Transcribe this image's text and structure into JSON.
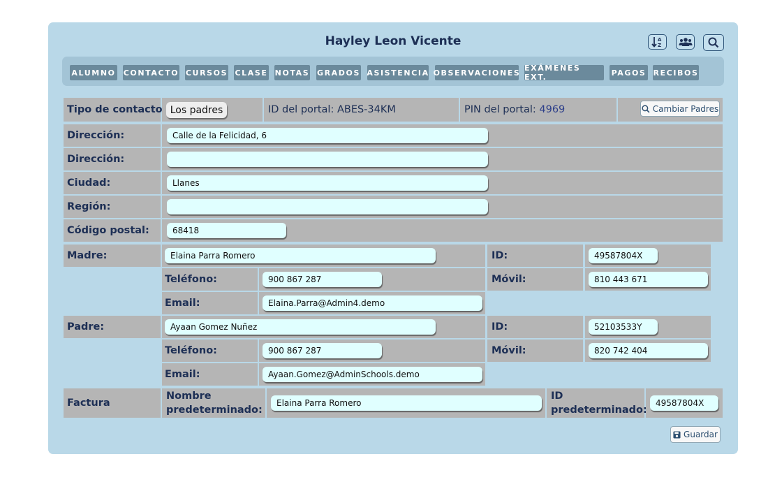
{
  "header": {
    "title": "Hayley Leon Vicente"
  },
  "toolbar": {
    "sort_icon": "sort-alpha-icon",
    "group_icon": "users-icon",
    "search_icon": "search-icon"
  },
  "tabs": [
    "ALUMNO",
    "CONTACTO",
    "CURSOS",
    "CLASE",
    "NOTAS",
    "GRADOS",
    "ASISTENCIA",
    "OBSERVACIONES",
    "EXÁMENES EXT.",
    "PAGOS",
    "RECIBOS"
  ],
  "form": {
    "tipo_label": "Tipo de contacto:",
    "tipo_value": "Los padres",
    "portal_id_label": "ID del portal:",
    "portal_id_value": "ABES-34KM",
    "pin_label": "PIN del portal:",
    "pin_value": "4969",
    "change_parents": "Cambiar Padres",
    "direccion1_label": "Dirección:",
    "direccion1_value": "Calle de la Felicidad, 6",
    "direccion2_label": "Dirección:",
    "direccion2_value": "",
    "ciudad_label": "Ciudad:",
    "ciudad_value": "Llanes",
    "region_label": "Región:",
    "region_value": "",
    "cp_label": "Código postal:",
    "cp_value": "68418",
    "madre_label": "Madre:",
    "madre_name": "Elaina Parra Romero",
    "madre_id_label": "ID:",
    "madre_id": "49587804X",
    "madre_tel_label": "Teléfono:",
    "madre_tel": "900 867 287",
    "madre_movil_label": "Móvil:",
    "madre_movil": "810 443 671",
    "madre_email_label": "Email:",
    "madre_email": "Elaina.Parra@Admin4.demo",
    "padre_label": "Padre:",
    "padre_name": "Ayaan Gomez Nuñez",
    "padre_id_label": "ID:",
    "padre_id": "52103533Y",
    "padre_tel_label": "Teléfono:",
    "padre_tel": "900 867 287",
    "padre_movil_label": "Móvil:",
    "padre_movil": "820 742 404",
    "padre_email_label": "Email:",
    "padre_email": "Ayaan.Gomez@AdminSchools.demo",
    "factura_label": "Factura",
    "nombre_pred_label_1": "Nombre",
    "nombre_pred_label_2": "predeterminado:",
    "nombre_pred_value": "Elaina Parra Romero",
    "id_pred_label_1": "ID",
    "id_pred_label_2": "predeterminado:",
    "id_pred_value": "49587804X"
  },
  "footer": {
    "save_label": "Guardar"
  }
}
